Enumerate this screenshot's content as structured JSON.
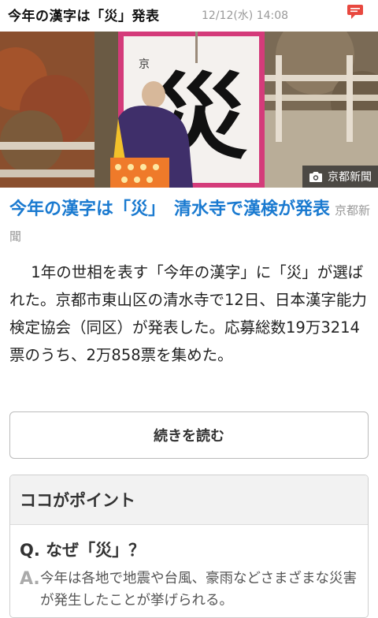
{
  "header": {
    "title": "今年の漢字は「災」発表",
    "datetime": "12/12(水) 14:08",
    "comment_icon": "speech-bubble-icon",
    "comment_color": "#e8483f"
  },
  "photo": {
    "kanji": "災",
    "credit": "京都新聞",
    "credit_icon": "camera-icon"
  },
  "article": {
    "headline": "今年の漢字は「災」　清水寺で漢検が発表",
    "source": "京都新聞",
    "body": "1年の世相を表す「今年の漢字」に「災」が選ばれた。京都市東山区の清水寺で12日、日本漢字能力検定協会（同区）が発表した。応募総数19万3214票のうち、2万858票を集めた。",
    "headline_color": "#1a7ad0"
  },
  "read_more": {
    "label": "続きを読む"
  },
  "points": {
    "title": "ココがポイント",
    "question": "Q. なぜ「災」？",
    "answer_label": "A.",
    "answer": "今年は各地で地震や台風、豪雨などさまざまな災害が発生したことが挙げられる。"
  }
}
